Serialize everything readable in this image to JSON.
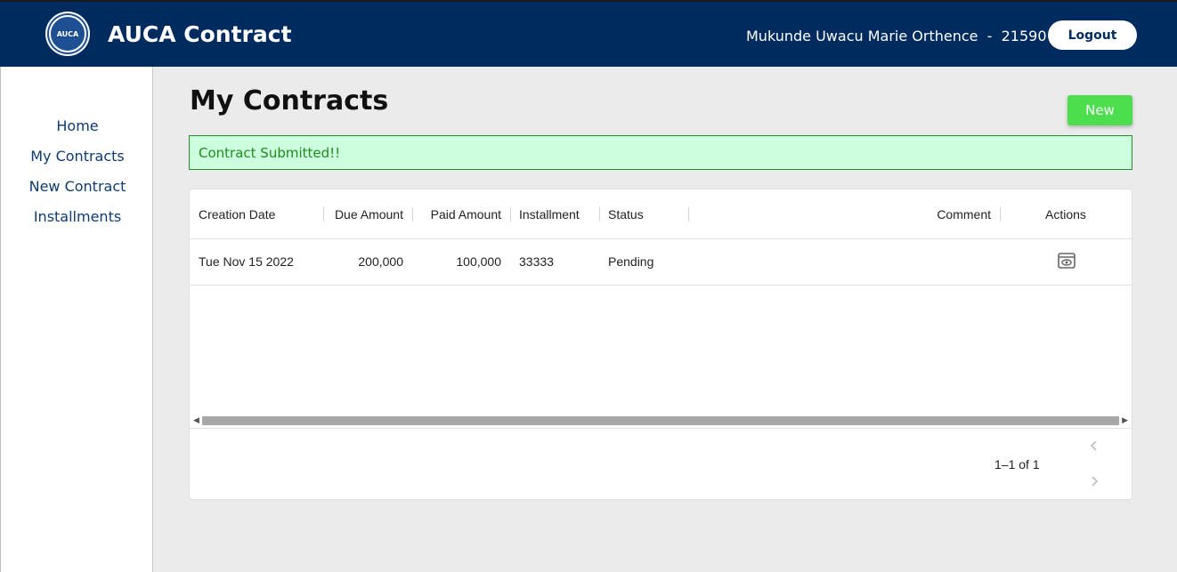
{
  "header": {
    "logo_text": "AUCA",
    "app_title": "AUCA Contract",
    "user_info": "Mukunde Uwacu Marie Orthence  -  21590",
    "logout_label": "Logout"
  },
  "sidebar": {
    "items": [
      {
        "label": "Home"
      },
      {
        "label": "My Contracts"
      },
      {
        "label": "New Contract"
      },
      {
        "label": "Installments"
      }
    ]
  },
  "main": {
    "page_title": "My Contracts",
    "new_button_label": "New",
    "alert_text": "Contract Submitted!!"
  },
  "table": {
    "columns": {
      "creation_date": "Creation Date",
      "due_amount": "Due Amount",
      "paid_amount": "Paid Amount",
      "installment": "Installment",
      "status": "Status",
      "comment": "Comment",
      "actions": "Actions"
    },
    "rows": [
      {
        "creation_date": "Tue Nov 15 2022",
        "due_amount": "200,000",
        "paid_amount": "100,000",
        "installment": "33333",
        "status": "Pending",
        "comment": "",
        "action_icon": "eye-icon"
      }
    ],
    "pagination": "1–1 of 1"
  },
  "colors": {
    "header_bg": "#002b5f",
    "new_button": "#4cde4c",
    "alert_bg": "#ccffdd",
    "alert_text": "#1f8a1f",
    "nav_link": "#0d3b74"
  }
}
